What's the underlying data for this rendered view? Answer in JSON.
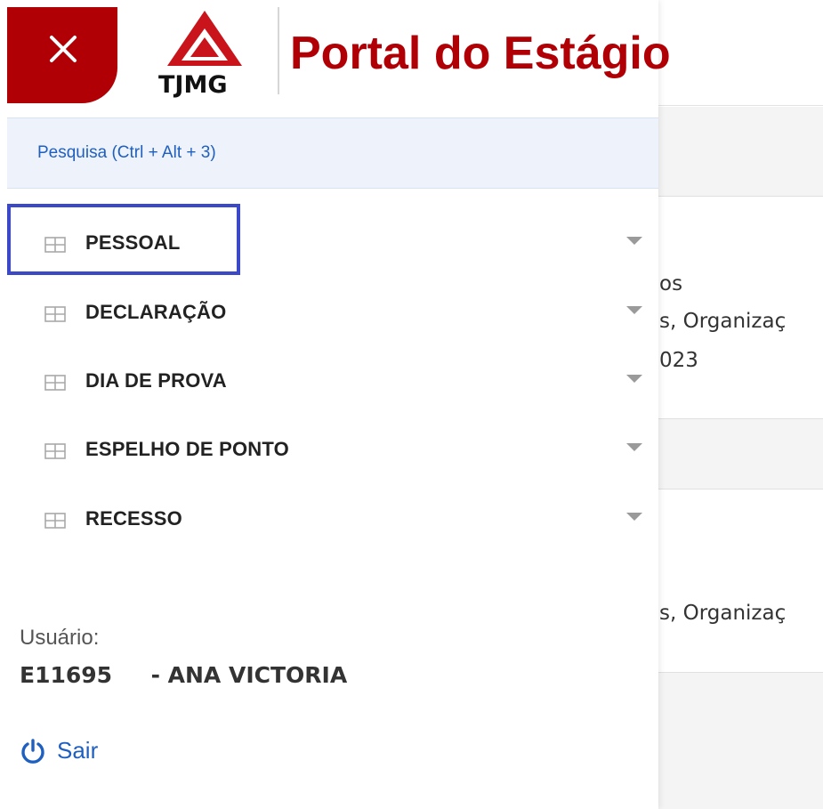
{
  "header": {
    "logo_text": "TJMG",
    "title": "Portal do Estágio",
    "close_icon": "close-icon"
  },
  "search": {
    "label": "Pesquisa (Ctrl + Alt + 3)"
  },
  "menu": {
    "items": [
      {
        "label": "PESSOAL",
        "icon": "table-icon"
      },
      {
        "label": "DECLARAÇÃO",
        "icon": "table-icon"
      },
      {
        "label": "DIA DE PROVA",
        "icon": "table-icon"
      },
      {
        "label": "ESPELHO DE PONTO",
        "icon": "table-icon"
      },
      {
        "label": "RECESSO",
        "icon": "table-icon"
      }
    ]
  },
  "user": {
    "label": "Usuário:",
    "value": "E11695     - ANA VICTORIA"
  },
  "logout": {
    "label": "Sair",
    "icon": "power-icon"
  },
  "background": {
    "lines": [
      "os",
      "s, Organizaç",
      "023",
      "s, Organizaç"
    ]
  },
  "colors": {
    "brand_red": "#b00005",
    "link_blue": "#1f5fbf",
    "highlight": "#3b49c9"
  }
}
